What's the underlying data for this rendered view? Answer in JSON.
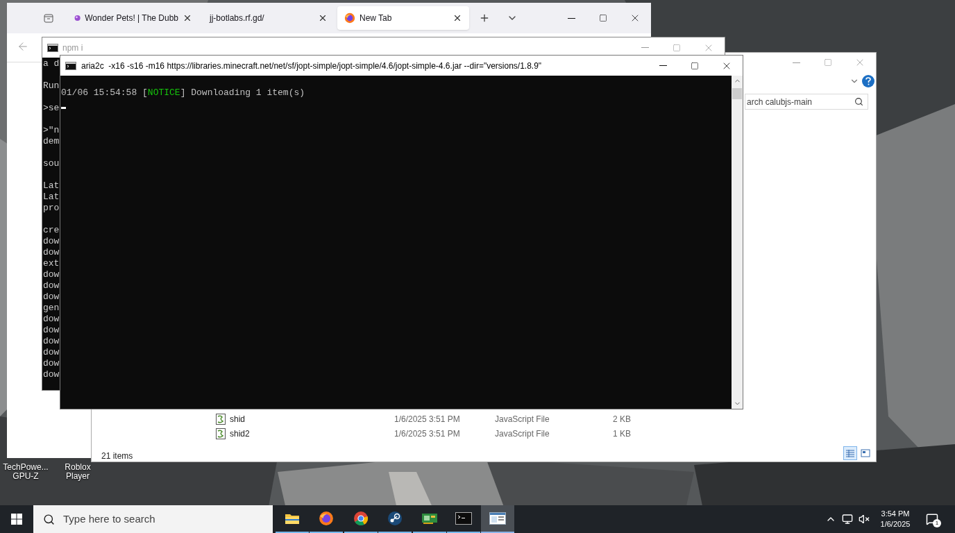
{
  "desktop_icons": [
    {
      "lines": [
        "TechPowe...",
        "GPU-Z"
      ]
    },
    {
      "lines": [
        "Roblox",
        "Player"
      ]
    }
  ],
  "browser": {
    "tabs": [
      {
        "title": "Wonder Pets! | The Dubb",
        "selected": false
      },
      {
        "title": "jj-botlabs.rf.gd/",
        "selected": false
      },
      {
        "title": "New Tab",
        "selected": true
      }
    ]
  },
  "npm_console": {
    "title": "npm i",
    "blocks": [
      [
        "a d"
      ],
      [
        "Run"
      ],
      [
        ">se"
      ],
      [
        ">\"n",
        "dem"
      ],
      [
        "sou"
      ],
      [
        "Lat",
        "Lat",
        "pro"
      ],
      [
        "cre",
        "dow",
        "dow",
        "ext",
        "dow",
        "dow",
        "dow",
        "gen",
        "dow",
        "dow",
        "dow",
        "dow",
        "dow",
        "dow"
      ]
    ]
  },
  "explorer": {
    "search": {
      "value": "arch calubjs-main"
    },
    "files": [
      {
        "name": "shid",
        "date": "1/6/2025 3:51 PM",
        "type": "JavaScript File",
        "size": "2 KB"
      },
      {
        "name": "shid2",
        "date": "1/6/2025 3:51 PM",
        "type": "JavaScript File",
        "size": "1 KB"
      }
    ],
    "status": "21 items",
    "views": [
      {
        "selected": true
      },
      {
        "selected": false
      }
    ]
  },
  "aria_console": {
    "title": "aria2c  -x16 -s16 -m16 https://libraries.minecraft.net/net/sf/jopt-simple/jopt-simple/4.6/jopt-simple-4.6.jar --dir=\"versions/1.8.9\"",
    "line": [
      {
        "text": "01/06 15:54:58 [",
        "color": "#c0c0c0"
      },
      {
        "text": "NOTICE",
        "color": "#16c60c"
      },
      {
        "text": "] Downloading 1 item(s)",
        "color": "#c0c0c0"
      }
    ]
  },
  "taskbar": {
    "search": {
      "placeholder": "Type here to search"
    },
    "apps": [
      {
        "selected": false
      },
      {
        "selected": false
      },
      {
        "selected": false
      },
      {
        "selected": false
      },
      {
        "selected": false
      },
      {
        "selected": false
      },
      {
        "selected": true
      }
    ],
    "clock": {
      "time": "3:54 PM",
      "date": "1/6/2025"
    },
    "notifications": "1"
  }
}
